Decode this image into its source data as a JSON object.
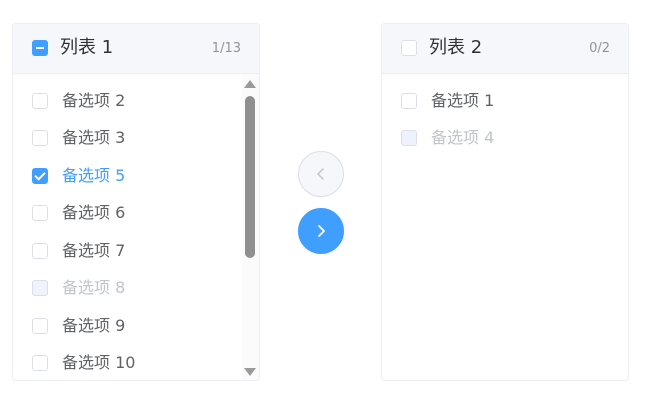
{
  "colors": {
    "primary": "#409eff",
    "text": "#606266",
    "title": "#303133",
    "muted": "#909399",
    "disabled_text": "#c0c4cc"
  },
  "left_panel": {
    "title": "列表 1",
    "count": "1/13",
    "header_checkbox_state": "indeterminate",
    "items": [
      {
        "label": "备选项 2",
        "checked": false,
        "disabled": false
      },
      {
        "label": "备选项 3",
        "checked": false,
        "disabled": false
      },
      {
        "label": "备选项 5",
        "checked": true,
        "disabled": false
      },
      {
        "label": "备选项 6",
        "checked": false,
        "disabled": false
      },
      {
        "label": "备选项 7",
        "checked": false,
        "disabled": false
      },
      {
        "label": "备选项 8",
        "checked": false,
        "disabled": true
      },
      {
        "label": "备选项 9",
        "checked": false,
        "disabled": false
      },
      {
        "label": "备选项 10",
        "checked": false,
        "disabled": false
      }
    ]
  },
  "right_panel": {
    "title": "列表 2",
    "count": "0/2",
    "header_checkbox_state": "unchecked",
    "items": [
      {
        "label": "备选项 1",
        "checked": false,
        "disabled": false
      },
      {
        "label": "备选项 4",
        "checked": false,
        "disabled": true
      }
    ]
  },
  "buttons": {
    "to_left_icon": "chevron-left-icon",
    "to_right_icon": "chevron-right-icon"
  }
}
